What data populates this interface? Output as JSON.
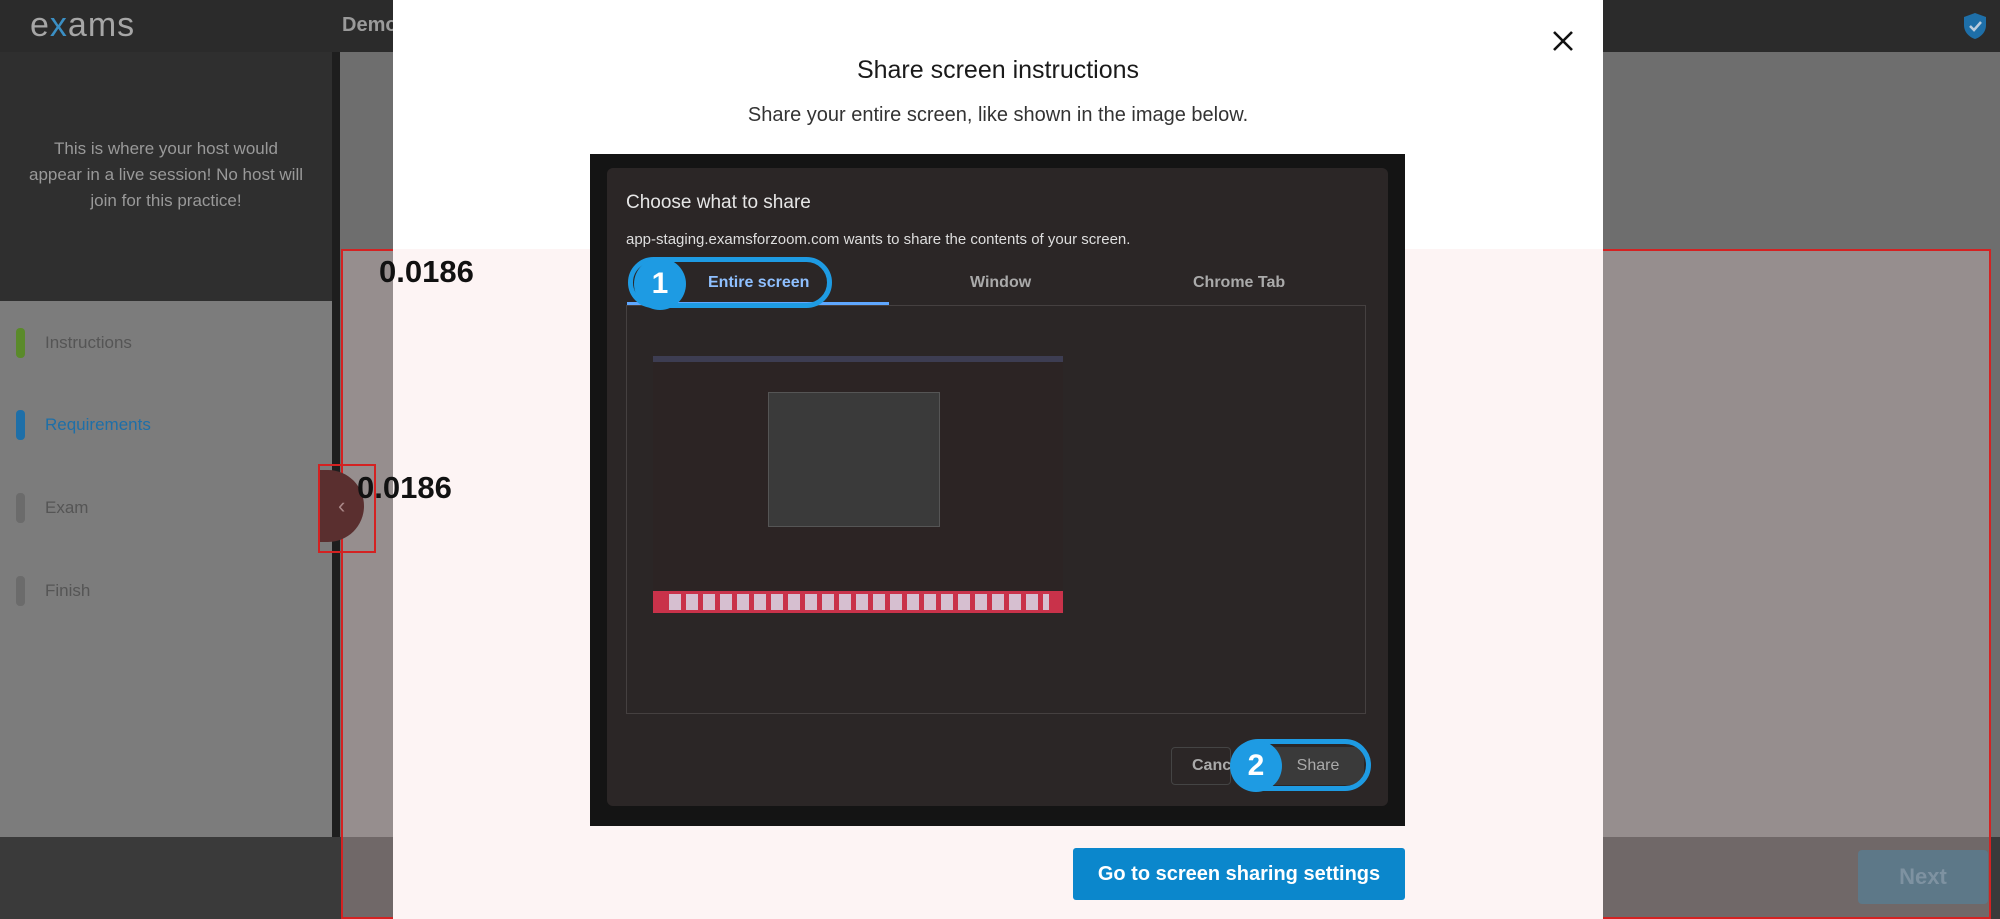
{
  "app": {
    "logo_prefix": "e",
    "logo_x": "x",
    "logo_suffix": "ams",
    "session_title": "Demo"
  },
  "sidebar": {
    "host_message": "This is where your host would appear in a live session! No host will join for this practice!",
    "steps": [
      {
        "label": "Instructions",
        "color": "#5a8a2a"
      },
      {
        "label": "Requirements",
        "color": "#1e6fa8"
      },
      {
        "label": "Exam",
        "color": "#666666"
      },
      {
        "label": "Finish",
        "color": "#666666"
      }
    ],
    "collapse_glyph": "‹"
  },
  "footer": {
    "next_label": "Next"
  },
  "metrics": {
    "top_value": "0.0186",
    "mid_value": "0.0186"
  },
  "modal": {
    "title": "Share screen instructions",
    "subtitle": "Share your entire screen, like shown in the image below.",
    "go_settings_label": "Go to screen sharing settings"
  },
  "example": {
    "dialog_title": "Choose what to share",
    "dialog_subtitle": "app-staging.examsforzoom.com wants to share the contents of your screen.",
    "tabs": [
      "Entire screen",
      "Window",
      "Chrome Tab"
    ],
    "cancel_label": "Canc",
    "share_label": "Share",
    "step1": "1",
    "step2": "2"
  },
  "colors": {
    "accent": "#1e9be3",
    "primary_button": "#0b87cc",
    "highlight_border": "#d42222"
  }
}
